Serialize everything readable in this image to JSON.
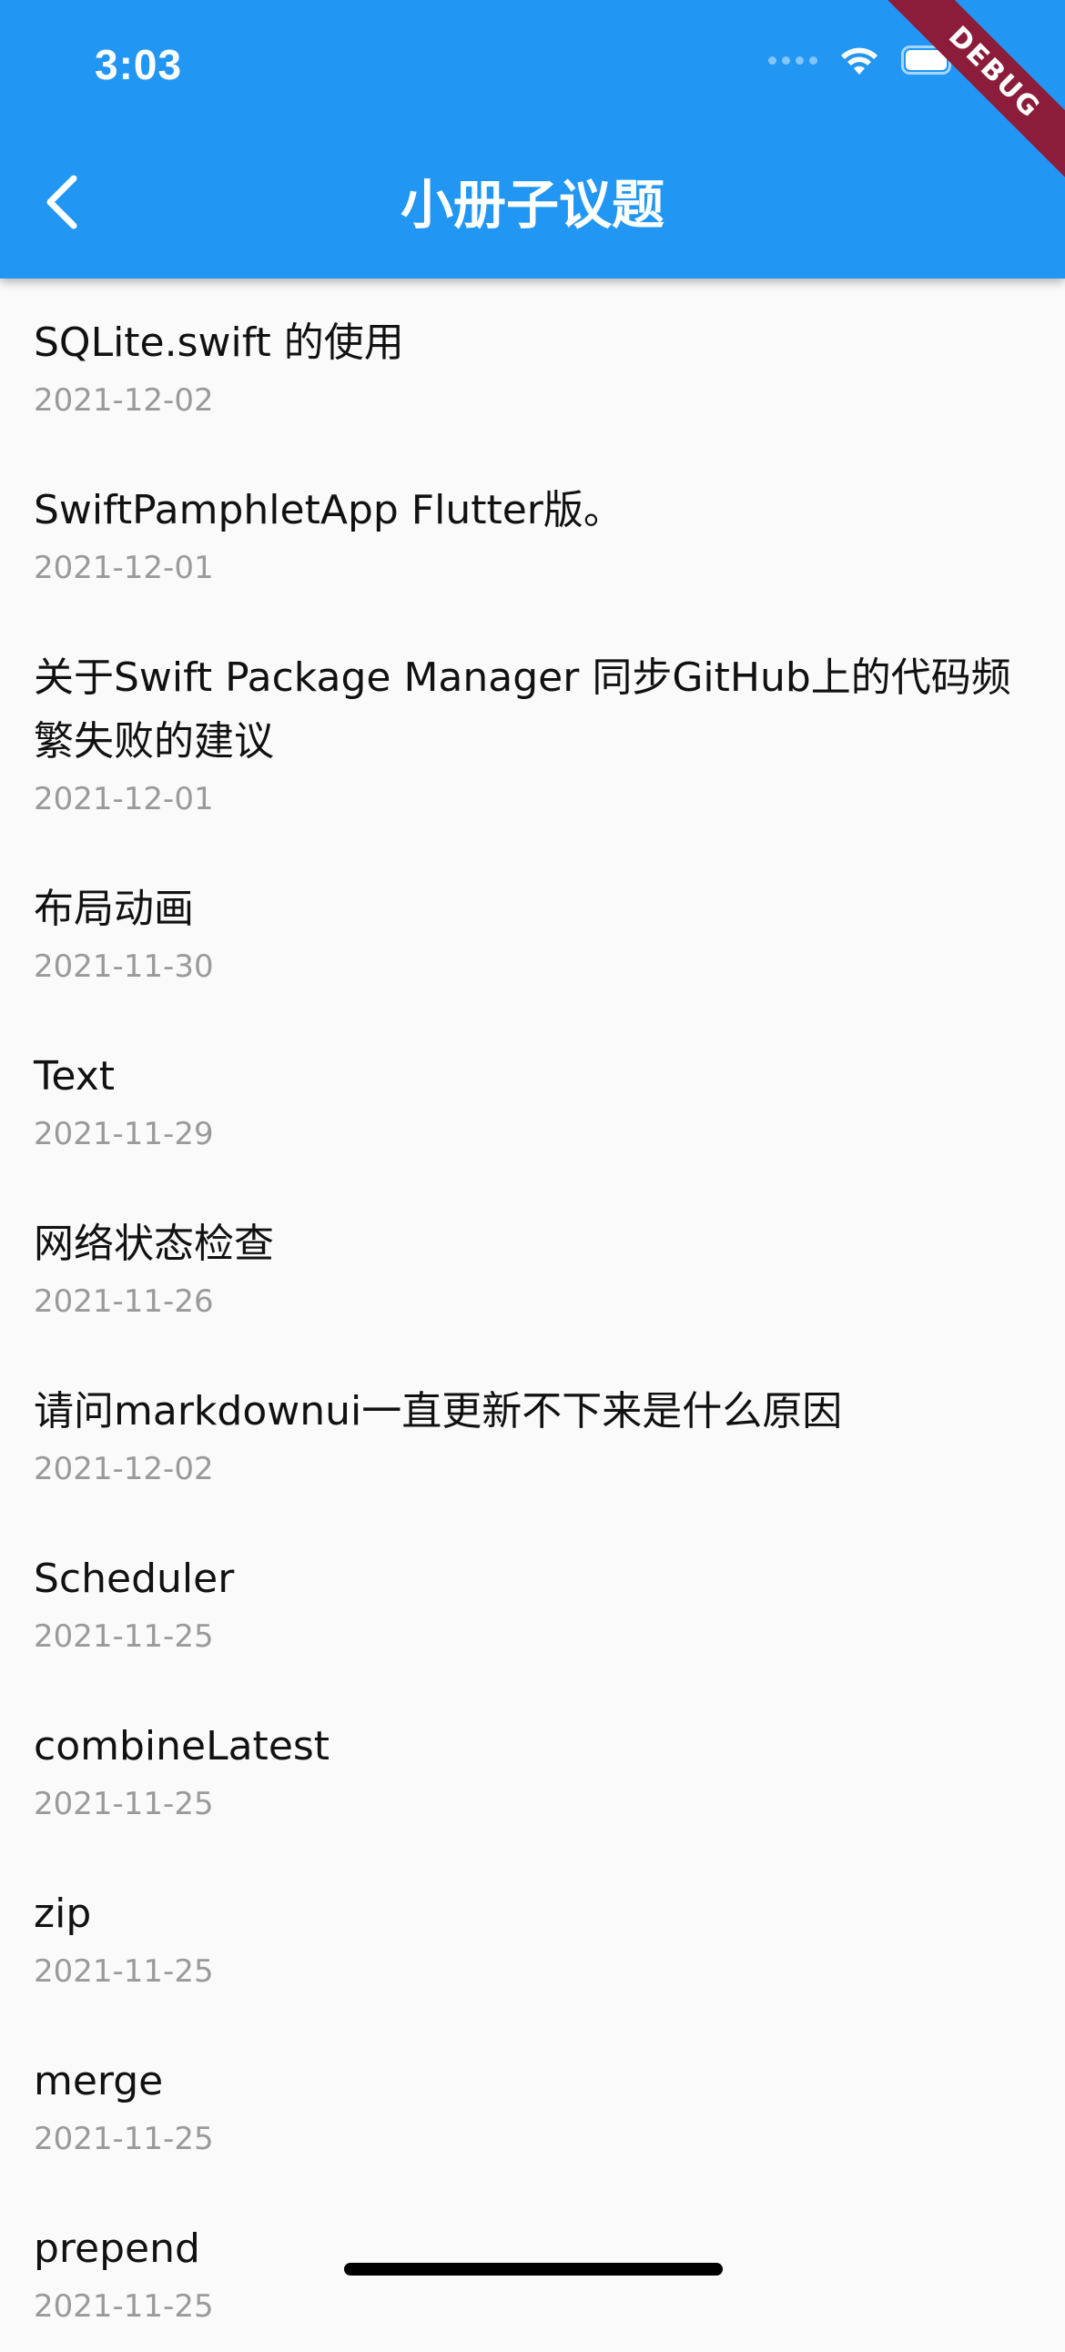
{
  "status_bar": {
    "time": "3:03"
  },
  "debug_banner": "DEBUG",
  "app_bar": {
    "title": "小册子议题"
  },
  "issues": [
    {
      "title": "SQLite.swift 的使用",
      "date": "2021-12-02"
    },
    {
      "title": "SwiftPamphletApp Flutter版。",
      "date": "2021-12-01"
    },
    {
      "title": "关于Swift Package Manager 同步GitHub上的代码频繁失败的建议",
      "date": "2021-12-01"
    },
    {
      "title": "布局动画",
      "date": "2021-11-30"
    },
    {
      "title": "Text",
      "date": "2021-11-29"
    },
    {
      "title": "网络状态检查",
      "date": "2021-11-26"
    },
    {
      "title": "请问markdownui一直更新不下来是什么原因",
      "date": "2021-12-02"
    },
    {
      "title": "Scheduler",
      "date": "2021-11-25"
    },
    {
      "title": "combineLatest",
      "date": "2021-11-25"
    },
    {
      "title": "zip",
      "date": "2021-11-25"
    },
    {
      "title": "merge",
      "date": "2021-11-25"
    },
    {
      "title": "prepend",
      "date": "2021-11-25"
    }
  ]
}
